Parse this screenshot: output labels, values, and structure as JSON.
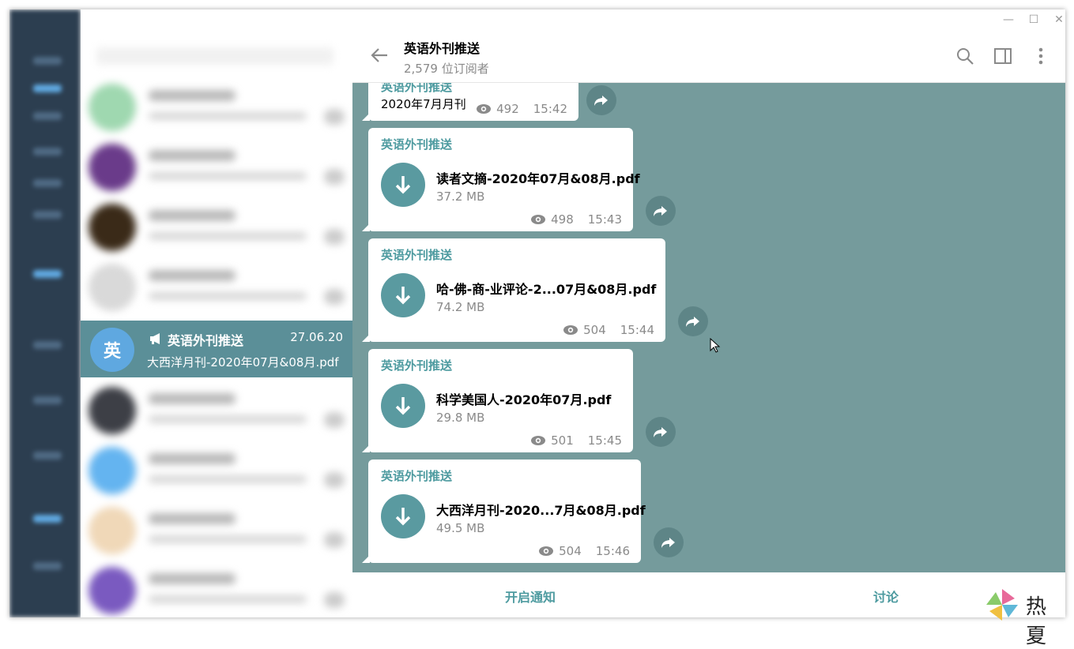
{
  "window": {
    "controls": {
      "minimize": "—",
      "maximize": "☐",
      "close": "✕"
    }
  },
  "chat_list": {
    "active_chat": {
      "avatar_letter": "英",
      "name": "英语外刊推送",
      "date": "27.06.20",
      "last_message": "大西洋月刊-2020年07月&08月.pdf"
    }
  },
  "header": {
    "title": "英语外刊推送",
    "subtitle": "2,579 位订阅者"
  },
  "messages": [
    {
      "sender": "英语外刊推送",
      "text": "2020年7月月刊",
      "views": "492",
      "time": "15:42"
    },
    {
      "sender": "英语外刊推送",
      "file_name": "读者文摘-2020年07月&08月.pdf",
      "file_size": "37.2 MB",
      "views": "498",
      "time": "15:43"
    },
    {
      "sender": "英语外刊推送",
      "file_name": "哈-佛-商-业评论-2...07月&08月.pdf",
      "file_size": "74.2 MB",
      "views": "504",
      "time": "15:44"
    },
    {
      "sender": "英语外刊推送",
      "file_name": "科学美国人-2020年07月.pdf",
      "file_size": "29.8 MB",
      "views": "501",
      "time": "15:45"
    },
    {
      "sender": "英语外刊推送",
      "file_name": "大西洋月刊-2020...7月&08月.pdf",
      "file_size": "49.5 MB",
      "views": "504",
      "time": "15:46"
    }
  ],
  "bottom": {
    "notify_label": "开启通知",
    "discuss_label": "讨论"
  },
  "watermark": {
    "text": "热夏"
  },
  "colors": {
    "accent": "#4e9ba0",
    "chat_background": "#759b9c",
    "active_chat": "#5b8f98",
    "avatar": "#5fa8e0"
  }
}
